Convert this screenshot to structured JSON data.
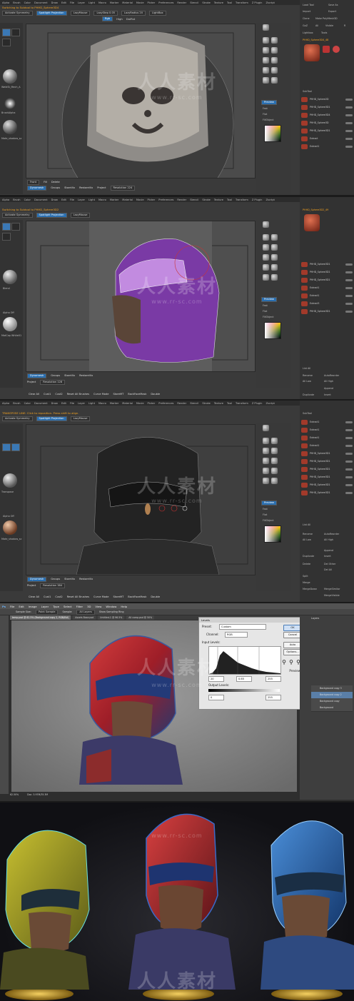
{
  "zbrush_menu": [
    "Alpha",
    "Brush",
    "Color",
    "Document",
    "Draw",
    "Edit",
    "File",
    "Layer",
    "Light",
    "Macro",
    "Marker",
    "Material",
    "Movie",
    "Picker",
    "Preferences",
    "Render",
    "Stencil",
    "Stroke",
    "Texture",
    "Tool",
    "Transform",
    "Z Plugin",
    "Zscript"
  ],
  "panel1": {
    "status": "Switching to Subtool to PHHD_Sphere3D4",
    "activate_symmetry": "Activate Symmetry",
    "spotlight": "Spotlight Projection",
    "lazymouse": "LazyMouse",
    "lazystep": "LazyStep 0.05",
    "lazyradius": "LazyRadius 20",
    "rgb": "Rgb",
    "high": "High",
    "dollst": "DolRst",
    "lightbox": "LightBox",
    "left_caption_1": "WeldSt_Mech_A",
    "left_caption_2": "BrushAlpha",
    "left_caption_3": "Mate_shadow_sc",
    "right_top": [
      "Load Tool",
      "Save As",
      "Import",
      "Export",
      "Clone",
      "Make PolyMesh3D",
      "GoZ",
      "All",
      "Visible",
      "R",
      "Lightbox",
      "Tools"
    ],
    "tool_name": "PHHD_Sphere3D4_48",
    "subtool_header": "SubTool",
    "subtools": [
      "PHHD_Sphere2D",
      "PHHD_Sphere3D1",
      "PHHD_Sphere3D4",
      "PHHD_Sphere3D",
      "PHHD_Sphere3D1",
      "Extract",
      "Extract1"
    ],
    "preview": "Preview",
    "fast": "Fast",
    "flat": "Flat",
    "fillobject": "FillObject",
    "bottom": [
      "Front",
      "Fill",
      "Delete",
      "Dynamesh",
      "Groups",
      "StoreVix",
      "RestoreVix",
      "Project",
      "Resolution 224"
    ]
  },
  "panel2": {
    "status": "Switching to Subtool to PHHD_Sphere3D2",
    "activate_symmetry": "Activate Symmetry",
    "spotlight": "Spotlight Projection",
    "lazymouse": "LazyMouse",
    "tool_name": "PHHD_Sphere3D2_49",
    "subtools": [
      "PHHD_Sphere3D1",
      "PHHD_Sphere3D1",
      "PHHD_Sphere3D1",
      "Extract1",
      "Extract1",
      "Extract3",
      "PHHD_Sphere3D1"
    ],
    "right_lower": [
      "List All",
      "Rename",
      "AutoReorder",
      "All Low",
      "All High",
      "Append",
      "Duplicate",
      "Insert"
    ],
    "bottom": [
      "Clear All",
      "Cust1",
      "Cust2",
      "Reset All Brushes",
      "Curve Mode",
      "StoreMT",
      "BackFaceMask",
      "Double",
      "Groups",
      "StoreVix",
      "RestoreVix",
      "Dynamesh",
      "Project",
      "Resolution 128"
    ],
    "left_caption_1": "Blend",
    "left_caption_2": "Alpha Off",
    "left_caption_3": "MatCap White01"
  },
  "panel3": {
    "status": "TRANSPOSE LINE: Click to reposition. Press shift to align.",
    "activate_symmetry": "Activate Symmetry",
    "spotlight": "Spotlight Projection",
    "lazymouse": "LazyMouse",
    "subtool_header": "SubTool",
    "subtools": [
      "Extract1",
      "Extract1",
      "Extract1",
      "Extract1",
      "PHHD_Sphere3D1",
      "PHHD_Sphere3D1",
      "PHHD_Sphere3D1",
      "PHHD_Sphere3D1",
      "PHHD_Sphere3D1",
      "PHHD_Sphere3D1"
    ],
    "right_lower": [
      "List All",
      "Rename",
      "AutoReorder",
      "All Low",
      "All High",
      "Append",
      "Duplicate",
      "Insert",
      "Delete",
      "Del Other",
      "Del All",
      "Split",
      "Merge",
      "MergeDown",
      "MergeSimilar",
      "MergeVisible"
    ],
    "bottom": [
      "Clear All",
      "Cust1",
      "Cust2",
      "Reset All Brushes",
      "Curve Mode",
      "StoreMT",
      "BackFaceMask",
      "Double",
      "Groups",
      "StoreVix",
      "RestoreVix",
      "Dynamesh",
      "Project",
      "Resolution 384"
    ],
    "left_caption_1": "Transpose",
    "left_caption_2": "Alpha Off",
    "left_caption_3": "Mate_shadow_sc"
  },
  "photoshop": {
    "logo": "Ps",
    "menu": [
      "File",
      "Edit",
      "Image",
      "Layer",
      "Type",
      "Select",
      "Filter",
      "3D",
      "View",
      "Window",
      "Help"
    ],
    "options": [
      "Sample Size:",
      "Point Sample",
      "Sample:",
      "All Layers",
      "Show Sampling Ring"
    ],
    "tabs": [
      "temp.psd @ 62.5% (Background copy 2, RGB/8#)",
      "Assets Base.psd",
      "Untitled-1 @ 96.5%",
      "All comp.psd @ 50%"
    ],
    "status_zoom": "62.50%",
    "status_doc": "Doc: 3.97M/35.3M",
    "levels": {
      "title": "Levels",
      "preset_label": "Preset:",
      "preset_value": "Custom",
      "channel_label": "Channel:",
      "channel_value": "RGB",
      "input_label": "Input Levels:",
      "input_values": [
        "20",
        "0.65",
        "255"
      ],
      "output_label": "Output Levels:",
      "output_values": [
        "0",
        "255"
      ],
      "buttons": [
        "OK",
        "Cancel",
        "Auto",
        "Options..."
      ],
      "preview": "Preview"
    },
    "layers": [
      "Background copy 3",
      "Background copy 2",
      "Background copy",
      "Background"
    ],
    "panel_tab": "Layers"
  },
  "watermark": {
    "brand": "人人素材",
    "url": "www.rr-sc.com"
  }
}
